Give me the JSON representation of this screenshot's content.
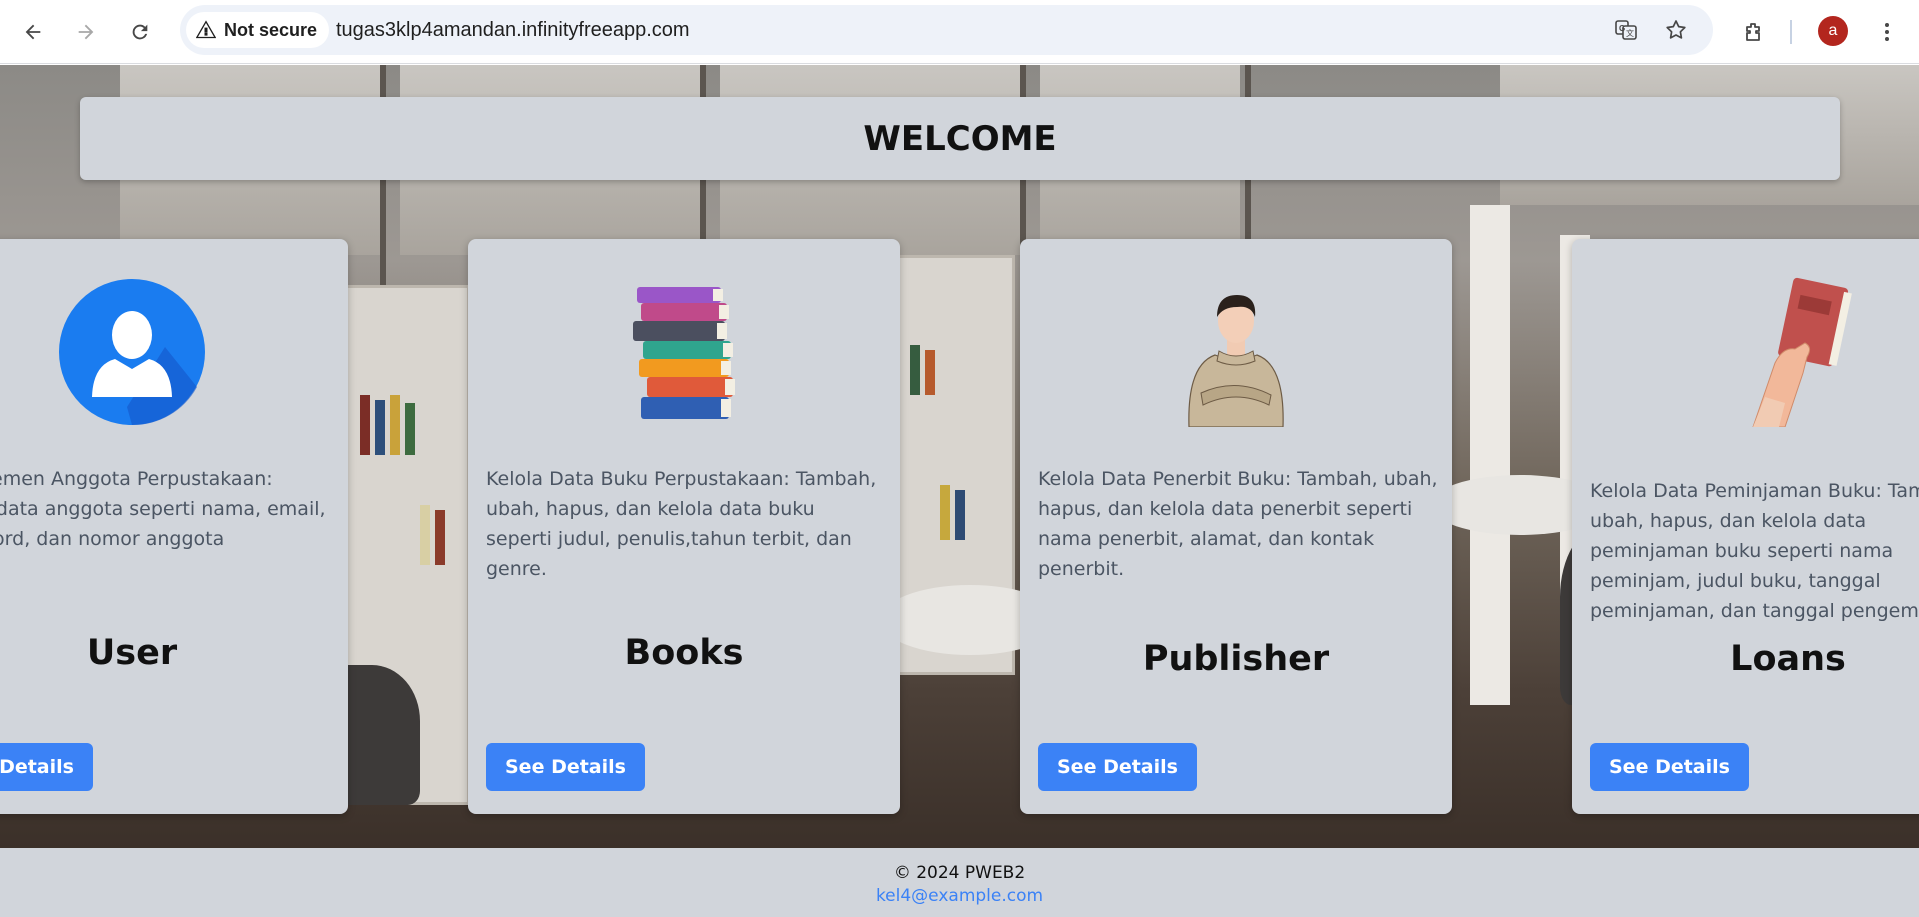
{
  "browser": {
    "security_label": "Not secure",
    "url": "tugas3klp4amandan.infinityfreeapp.com",
    "profile_initial": "a",
    "icons": [
      "back-arrow-icon",
      "forward-arrow-icon",
      "reload-icon",
      "warning-icon",
      "translate-icon",
      "star-icon",
      "extensions-icon",
      "menu-dots-icon"
    ]
  },
  "page": {
    "welcome": "WELCOME",
    "cards": [
      {
        "title": "User",
        "description": "Manajemen Anggota Perpustakaan: kelola data anggota seperti nama, email, password, dan nomor anggota",
        "button": "See Details",
        "image": "user-avatar-icon"
      },
      {
        "title": "Books",
        "description": "Kelola Data Buku Perpustakaan: Tambah, ubah, hapus, dan kelola data buku seperti judul, penulis,tahun terbit, dan genre.",
        "button": "See Details",
        "image": "book-stack-icon"
      },
      {
        "title": "Publisher",
        "description": "Kelola Data Penerbit Buku: Tambah, ubah, hapus, dan kelola data penerbit seperti nama penerbit, alamat, dan kontak penerbit.",
        "button": "See Details",
        "image": "publisher-person-icon"
      },
      {
        "title": "Loans",
        "description": "Kelola Data Peminjaman Buku: Tambah, ubah, hapus, dan kelola data peminjaman buku seperti nama peminjam, judul buku, tanggal peminjaman, dan tanggal pengembalian.",
        "button": "See Details",
        "image": "hand-holding-book-icon"
      }
    ],
    "footer": {
      "copyright": "© 2024 PWEB2",
      "email": "kel4@example.com"
    }
  },
  "colors": {
    "card_bg": "#d1d5db",
    "button_blue": "#3b82f6",
    "link_blue": "#3b82f6",
    "avatar_red": "#b3261e"
  }
}
